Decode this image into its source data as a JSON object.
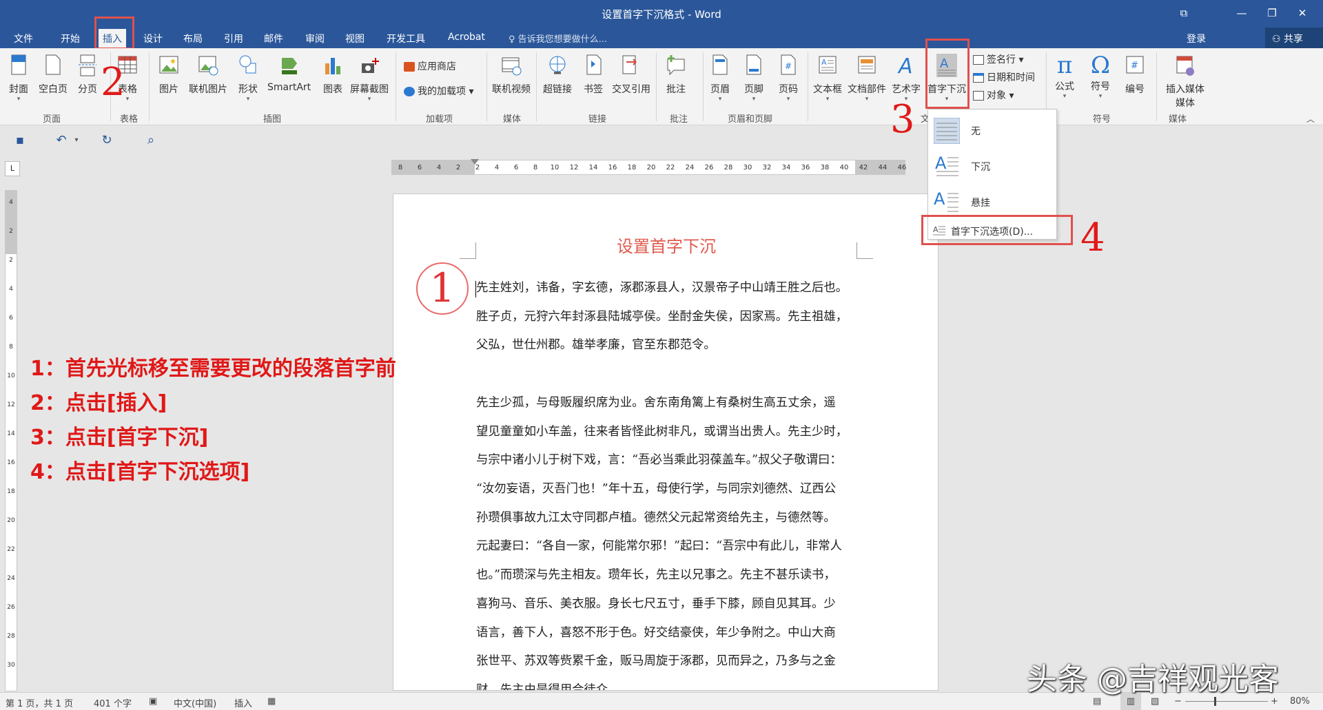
{
  "window": {
    "title": "设置首字下沉格式 - Word",
    "controls": [
      "restore-ribbon-icon",
      "minimize-icon",
      "maximize-icon",
      "close-icon"
    ]
  },
  "tabs": [
    "文件",
    "开始",
    "插入",
    "设计",
    "布局",
    "引用",
    "邮件",
    "审阅",
    "视图",
    "开发工具",
    "Acrobat"
  ],
  "active_tab": "插入",
  "tellme": "告诉我您想要做什么...",
  "account": {
    "login": "登录",
    "share": "共享"
  },
  "ribbon": {
    "pages": {
      "label": "页面",
      "cover": "封面",
      "blank": "空白页",
      "break": "分页"
    },
    "tables": {
      "label": "表格",
      "table": "表格"
    },
    "illustrations": {
      "label": "插图",
      "picture": "图片",
      "online_picture": "联机图片",
      "shapes": "形状",
      "smartart": "SmartArt",
      "chart": "图表",
      "screenshot": "屏幕截图"
    },
    "addins": {
      "label": "加载项",
      "store": "应用商店",
      "my_addins": "我的加载项"
    },
    "media": {
      "label": "媒体",
      "online_video": "联机视频"
    },
    "links": {
      "label": "链接",
      "hyperlink": "超链接",
      "bookmark": "书签",
      "cross_ref": "交叉引用"
    },
    "comments": {
      "label": "批注",
      "comment": "批注"
    },
    "header_footer": {
      "label": "页眉和页脚",
      "header": "页眉",
      "footer": "页脚",
      "page_number": "页码"
    },
    "text": {
      "label": "文",
      "textbox": "文本框",
      "quickparts": "文档部件",
      "wordart": "艺术字",
      "dropcap": "首字下沉",
      "signature": "签名行",
      "datetime": "日期和时间",
      "object": "对象"
    },
    "symbols": {
      "label": "符号",
      "equation": "公式",
      "symbol": "符号",
      "number": "编号"
    },
    "media2": {
      "label": "媒体",
      "insert_media": "插入媒体"
    }
  },
  "dropcap_menu": {
    "none": "无",
    "dropped": "下沉",
    "in_margin": "悬挂",
    "options": "首字下沉选项(D)..."
  },
  "ruler": {
    "h_numbers": [
      "8",
      "6",
      "4",
      "2",
      "2",
      "4",
      "6",
      "8",
      "10",
      "12",
      "14",
      "16",
      "18",
      "20",
      "22",
      "24",
      "26",
      "28",
      "30",
      "32",
      "34",
      "36",
      "38",
      "40",
      "42",
      "44",
      "46"
    ],
    "v_numbers": [
      "4",
      "2",
      "2",
      "4",
      "6",
      "8",
      "10",
      "12",
      "14",
      "16",
      "18",
      "20",
      "22",
      "24",
      "26",
      "28",
      "30"
    ],
    "corner": "L"
  },
  "document": {
    "title": "设置首字下沉",
    "para1": [
      "先主姓刘，讳备，字玄德，涿郡涿县人，汉景帝子中山靖王胜之后也。",
      "胜子贞，元狩六年封涿县陆城亭侯。坐酎金失侯，因家焉。先主祖雄，",
      "父弘，世仕州郡。雄举孝廉，官至东郡范令。"
    ],
    "para2": [
      "先主少孤，与母贩履织席为业。舍东南角篱上有桑树生高五丈余，遥",
      "望见童童如小车盖，往来者皆怪此树非凡，或谓当出贵人。先主少时，",
      "与宗中诸小儿于树下戏，言：“吾必当乘此羽葆盖车。”叔父子敬谓曰：",
      "“汝勿妄语，灭吾门也！”年十五，母使行学，与同宗刘德然、辽西公",
      "孙瓒俱事故九江太守同郡卢植。德然父元起常资给先主，与德然等。",
      "元起妻曰：“各自一家，何能常尔邪！”起曰：“吾宗中有此儿，非常人",
      "也。”而瓒深与先主相友。瓒年长，先主以兄事之。先主不甚乐读书，",
      "喜狗马、音乐、美衣服。身长七尺五寸，垂手下膝，顾自见其耳。少",
      "语言，善下人，喜怒不形于色。好交结豪侠，年少争附之。中山大商",
      "张世平、苏双等赀累千金，贩马周旋于涿郡，见而异之，乃多与之金",
      "财。先主由是得用合徒众。"
    ]
  },
  "annotations": {
    "circle1": "1",
    "n2": "2",
    "n3": "3",
    "n4": "4",
    "steps": [
      "1：首先光标移至需要更改的段落首字前",
      "2：点击[插入]",
      "3：点击[首字下沉]",
      "4：点击[首字下沉选项]"
    ],
    "color": "#e01818"
  },
  "status": {
    "page": "第 1 页，共 1 页",
    "words": "401 个字",
    "lang": "中文(中国)",
    "mode": "插入",
    "zoom": "80%"
  },
  "watermark": "头条 @吉祥观光客",
  "colors": {
    "accent": "#2b579a",
    "highlight": "#e0504d",
    "doc_title": "#e05a4e"
  }
}
